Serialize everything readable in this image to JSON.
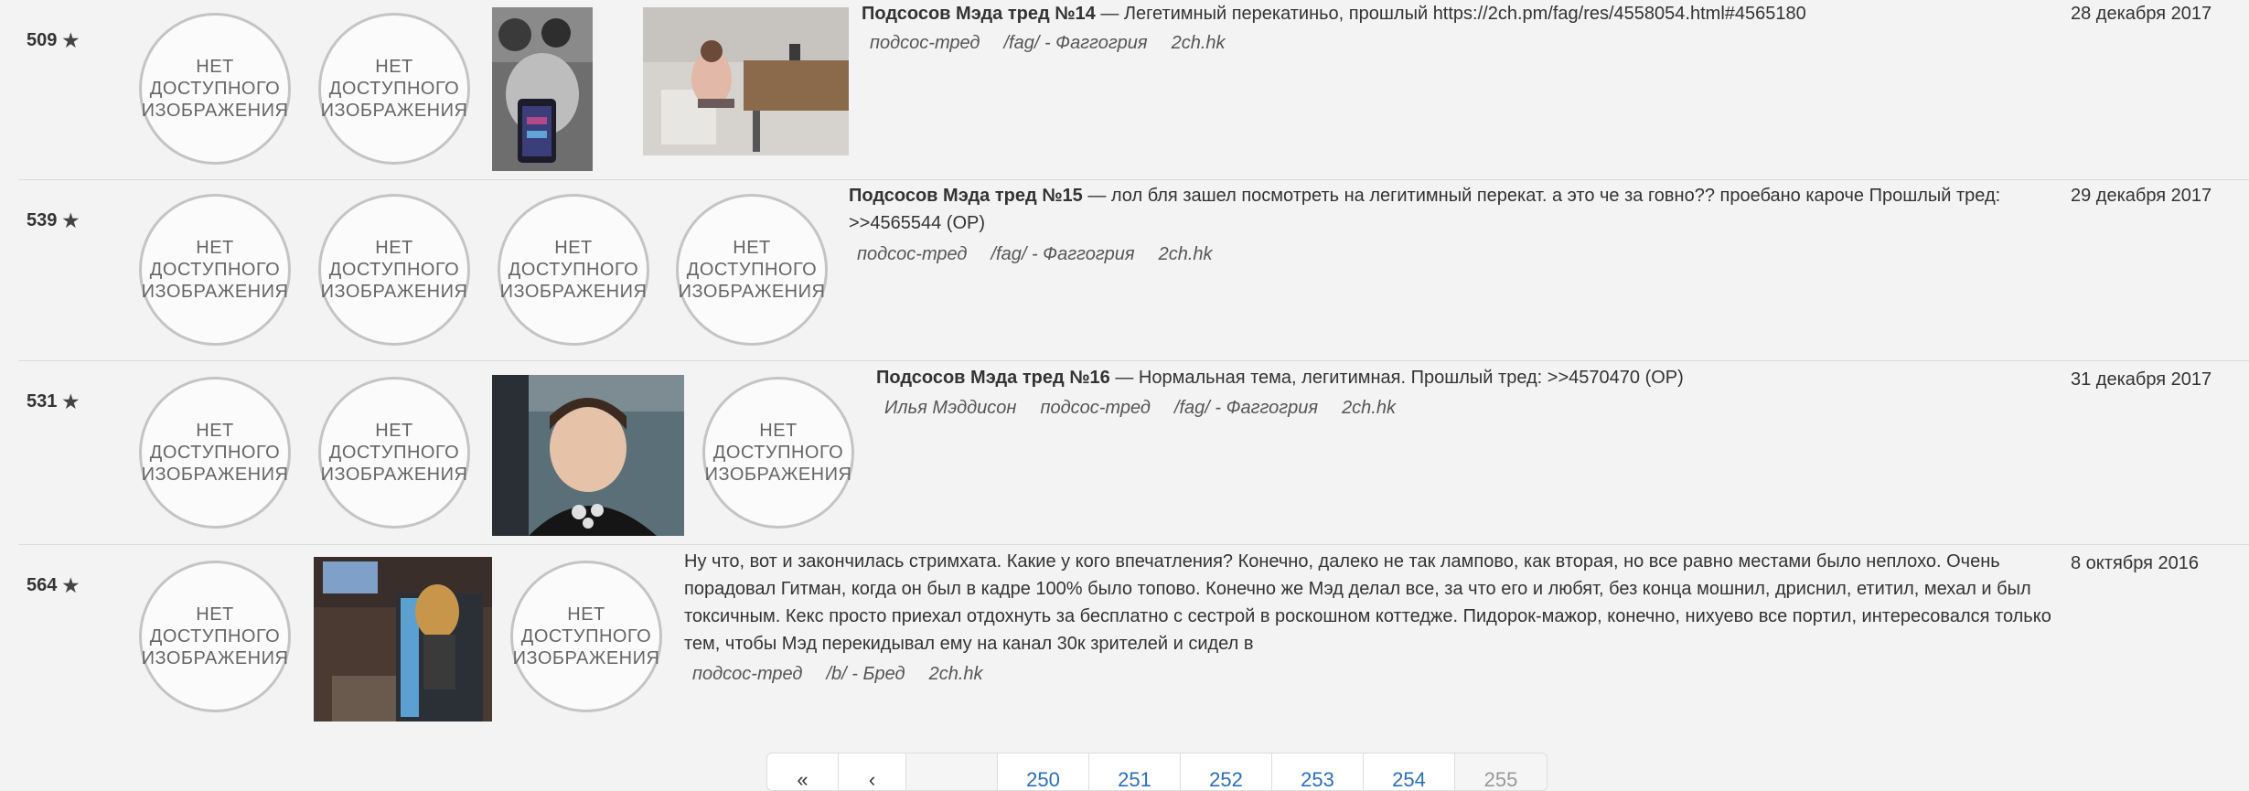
{
  "no_image_label": "НЕТ\nДОСТУПНОГО\nИЗОБРАЖЕНИЯ",
  "threads": [
    {
      "score": "509",
      "title": "Подсосов Мэда тред №14",
      "body": " — Легетимный перекатиньо, прошлый https://2ch.pm/fag/res/4558054.html#4565180",
      "tags": [
        "подсос-тред",
        "/fag/ - Фаггогрия",
        "2ch.hk"
      ],
      "date": "28 декабря 2017"
    },
    {
      "score": "539",
      "title": "Подсосов Мэда тред №15",
      "body": " — лол бля зашел посмотреть на легитимный перекат. а это че за говно?? проебано кароче Прошлый тред: >>4565544 (OP)",
      "tags": [
        "подсос-тред",
        "/fag/ - Фаггогрия",
        "2ch.hk"
      ],
      "date": "29 декабря 2017"
    },
    {
      "score": "531",
      "title": "Подсосов Мэда тред №16",
      "body": " — Нормальная тема, легитимная. Прошлый тред: >>4570470 (OP)",
      "tags": [
        "Илья Мэддисон",
        "подсос-тред",
        "/fag/ - Фаггогрия",
        "2ch.hk"
      ],
      "date": "31 декабря 2017"
    },
    {
      "score": "564",
      "title": "",
      "body": "Ну что, вот и закончилась стримхата. Какие у кого впечатления? Конечно, далеко не так лампово, как вторая, но все равно местами было неплохо. Очень порадовал Гитман, когда он был в кадре 100% было топово. Конечно же Мэд делал все, за что его и любят, без конца мошнил, дриснил, етитил, мехал и был токсичным. Кекс просто приехал отдохнуть за бесплатно с сестрой в роскошном коттедже. Пидорок-мажор, конечно, нихуево все портил, интересовался только тем, чтобы Мэд перекидывал ему на канал 30к зрителей и сидел в",
      "tags": [
        "подсос-тред",
        "/b/ - Бред",
        "2ch.hk"
      ],
      "date": "8 октября 2016"
    }
  ],
  "pagination": {
    "pages": [
      "«",
      "‹",
      "",
      "250",
      "251",
      "252",
      "253",
      "254",
      "255"
    ]
  }
}
